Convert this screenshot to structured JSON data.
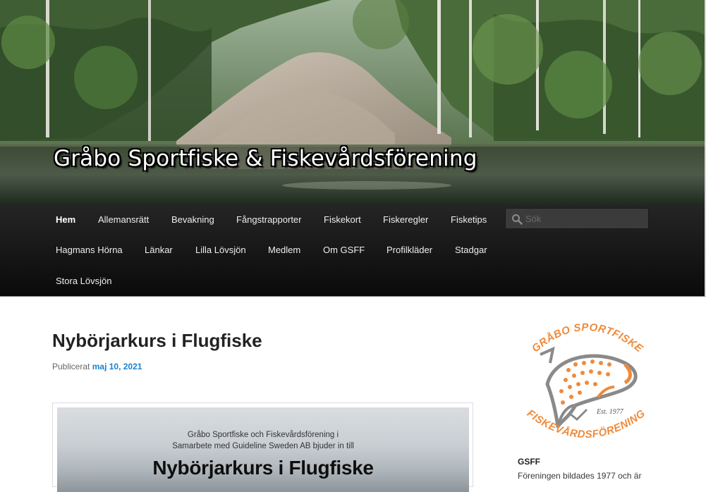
{
  "site": {
    "title": "Gråbo Sportfiske & Fiskevårdsförening"
  },
  "nav": {
    "items": [
      {
        "label": "Hem",
        "active": true
      },
      {
        "label": "Allemansrätt"
      },
      {
        "label": "Bevakning"
      },
      {
        "label": "Fångstrapporter"
      },
      {
        "label": "Fiskekort"
      },
      {
        "label": "Fiskeregler"
      },
      {
        "label": "Fisketips"
      },
      {
        "label": "Hagmans Hörna"
      },
      {
        "label": "Länkar"
      },
      {
        "label": "Lilla Lövsjön"
      },
      {
        "label": "Medlem"
      },
      {
        "label": "Om GSFF"
      },
      {
        "label": "Profilkläder"
      },
      {
        "label": "Stadgar"
      },
      {
        "label": "Stora Lövsjön"
      }
    ],
    "search": {
      "placeholder": "Sök",
      "icon": "search-icon"
    }
  },
  "post": {
    "title": "Nybörjarkurs i Flugfiske",
    "meta_prefix": "Publicerat",
    "date": "maj 10, 2021",
    "image": {
      "line1": "Gråbo Sportfiske och Fiskevårdsförening i",
      "line2": "Samarbete med Guideline Sweden AB bjuder in till",
      "headline": "Nybörjarkurs i Flugfiske"
    }
  },
  "sidebar": {
    "logo": {
      "top_text": "GRÅBO SPORTFISKE",
      "bottom_text": "FISKEVÅRDSFÖRENING",
      "est": "Est. 1977"
    },
    "widget_title": "GSFF",
    "widget_text": "Föreningen bildades 1977 och är"
  },
  "colors": {
    "accent": "#1982d1",
    "nav_bg": "#1a1a1a",
    "logo_orange": "#f08a3a"
  }
}
